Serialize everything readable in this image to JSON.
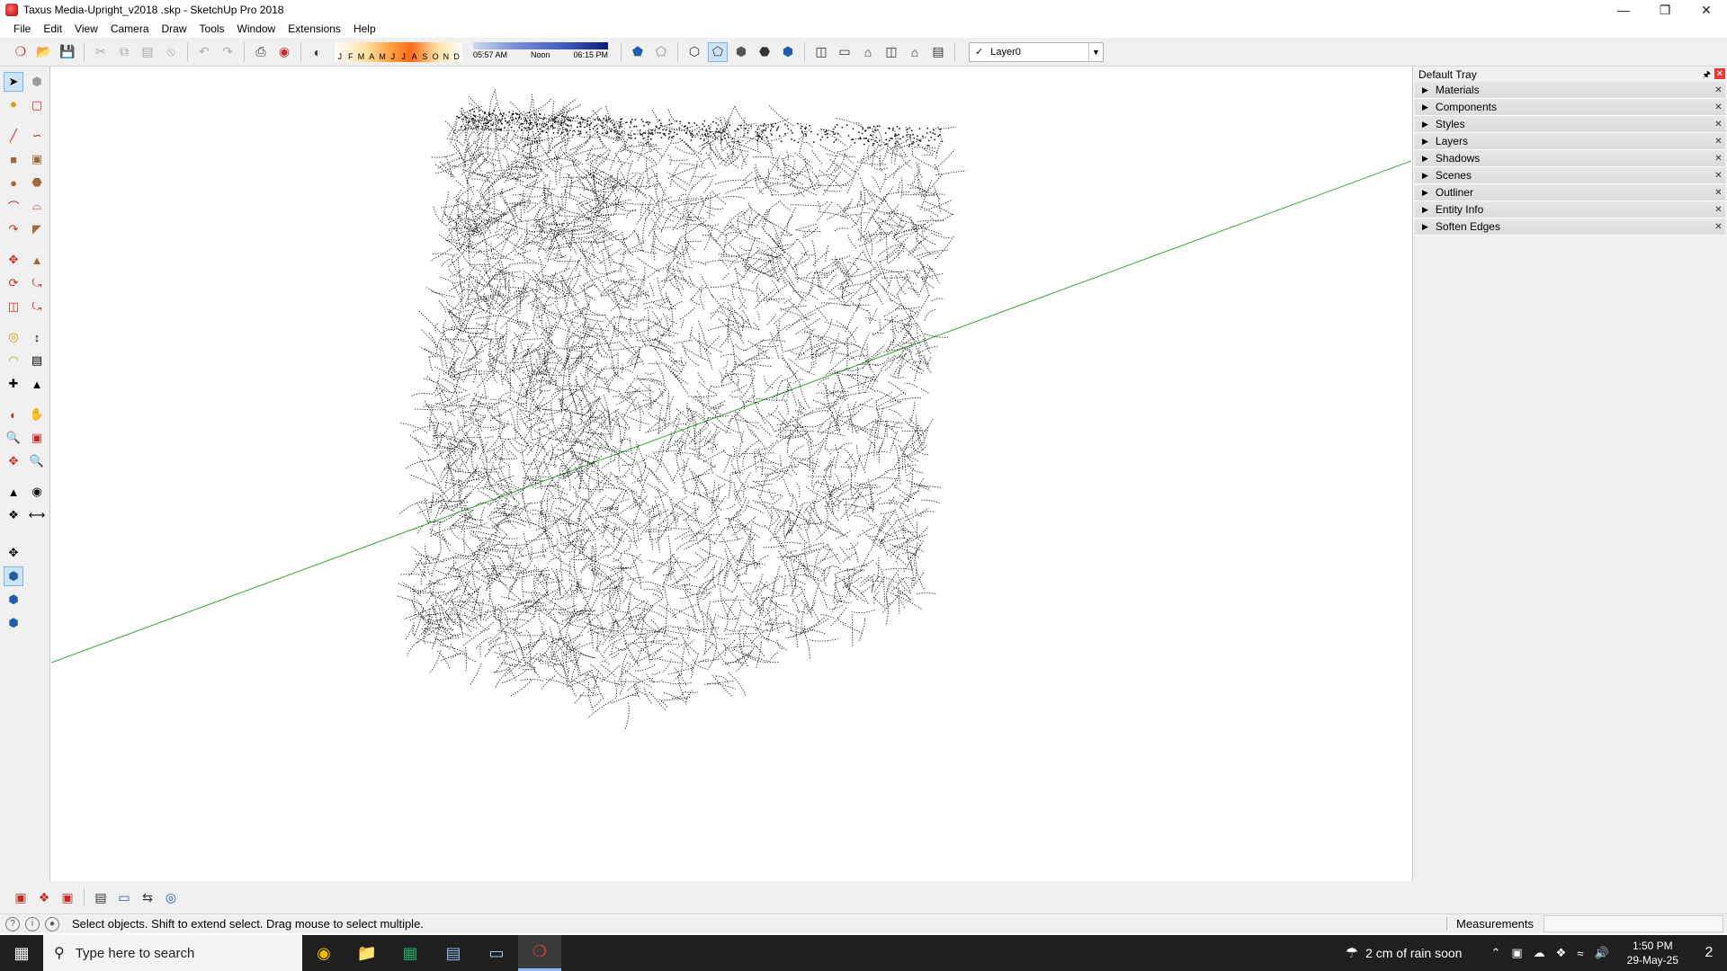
{
  "window": {
    "title": "Taxus Media-Upright_v2018 .skp - SketchUp Pro 2018",
    "minimize_icon": "minimize-icon",
    "maximize_icon": "restore-icon",
    "close_icon": "close-icon"
  },
  "menu": [
    "File",
    "Edit",
    "View",
    "Camera",
    "Draw",
    "Tools",
    "Window",
    "Extensions",
    "Help"
  ],
  "toolbar": {
    "months": [
      "J",
      "F",
      "M",
      "A",
      "M",
      "J",
      "J",
      "A",
      "S",
      "O",
      "N",
      "D"
    ],
    "time_start": "05:57 AM",
    "time_mid": "Noon",
    "time_end": "06:15 PM",
    "layer": "Layer0"
  },
  "tray": {
    "title": "Default Tray",
    "items": [
      "Materials",
      "Components",
      "Styles",
      "Layers",
      "Shadows",
      "Scenes",
      "Outliner",
      "Entity Info",
      "Soften Edges"
    ]
  },
  "status": {
    "hint": "Select objects. Shift to extend select. Drag mouse to select multiple.",
    "measurements_label": "Measurements",
    "measurements_value": ""
  },
  "taskbar": {
    "search_placeholder": "Type here to search",
    "weather": "2 cm of rain soon",
    "time": "1:50 PM",
    "date": "29-May-25",
    "notification_count": "2"
  },
  "colors": {
    "axis_green": "#3fa33f",
    "tray_close": "#e03a3a",
    "taskbar_bg": "#1f1f1f"
  }
}
